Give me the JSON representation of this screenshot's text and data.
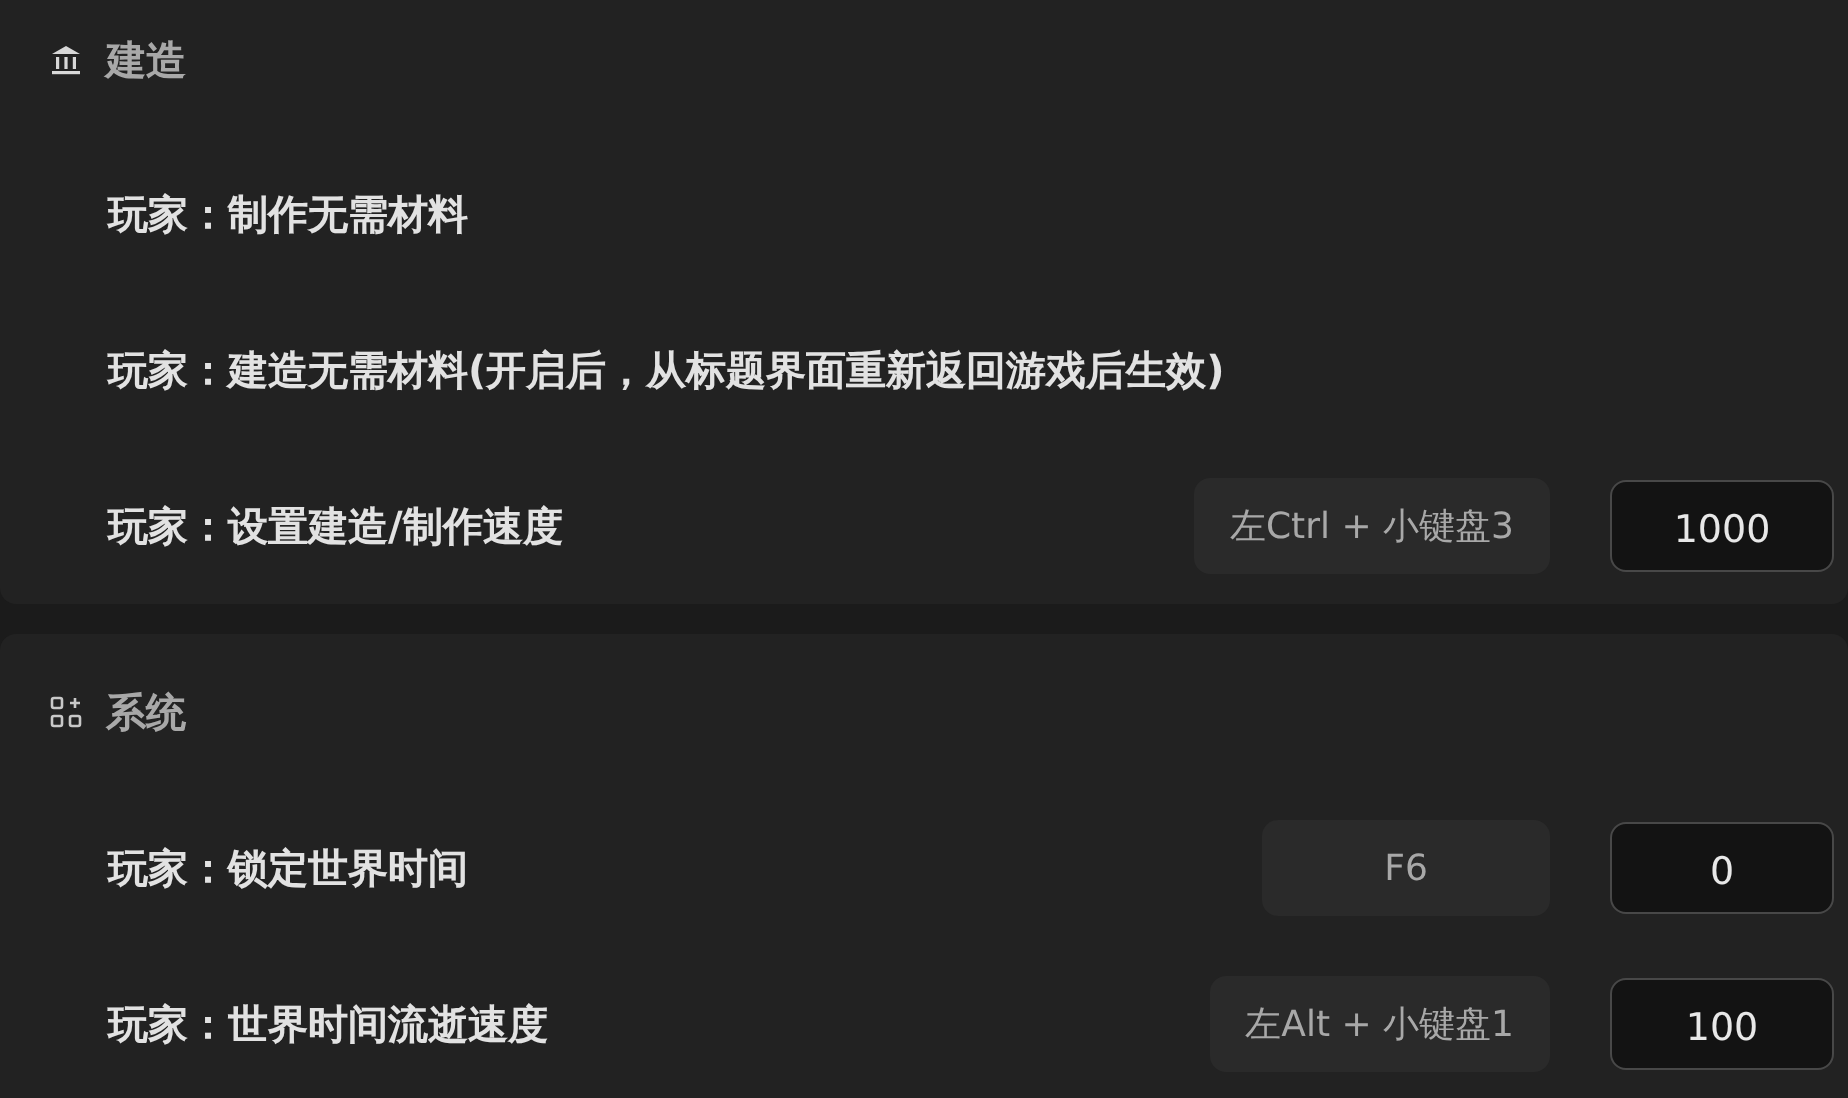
{
  "sections": [
    {
      "kind": "build",
      "title": "建造",
      "rows": [
        {
          "label": "玩家：制作无需材料"
        },
        {
          "label": "玩家：建造无需材料(开启后，从标题界面重新返回游戏后生效)"
        },
        {
          "label": "玩家：设置建造/制作速度",
          "hotkey": "左Ctrl + 小键盘3",
          "value": "1000"
        }
      ]
    },
    {
      "kind": "system",
      "title": "系统",
      "rows": [
        {
          "label": "玩家：锁定世界时间",
          "hotkey": "F6",
          "value": "0"
        },
        {
          "label": "玩家：世界时间流逝速度",
          "hotkey": "左Alt + 小键盘1",
          "value": "100"
        }
      ]
    }
  ]
}
